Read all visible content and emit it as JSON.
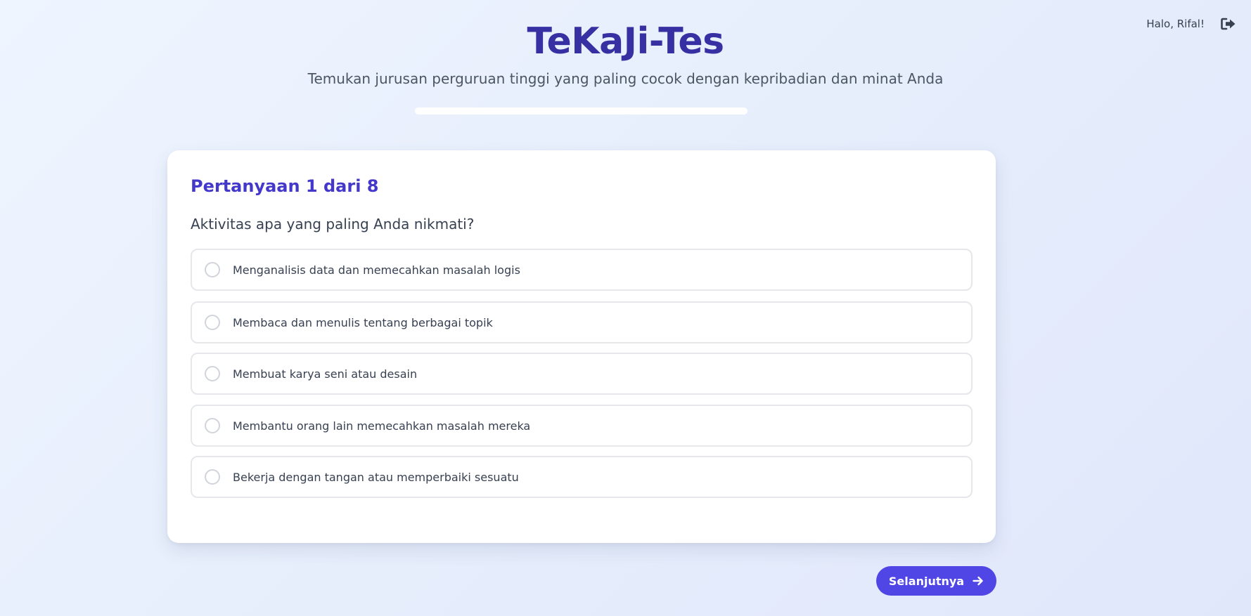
{
  "user": {
    "greeting": "Halo, Rifal!",
    "logout_icon": "sign-out-icon"
  },
  "header": {
    "title": "TeKaJi-Tes",
    "subtitle": "Temukan jurusan perguruan tinggi yang paling cocok dengan kepribadian dan minat Anda"
  },
  "progress": {
    "current": 0,
    "total": 8,
    "fill_fraction": 0
  },
  "question": {
    "counter": "Pertanyaan 1 dari 8",
    "text": "Aktivitas apa yang paling Anda nikmati?",
    "options": [
      {
        "label": "Menganalisis data dan memecahkan masalah logis",
        "selected": false
      },
      {
        "label": "Membaca dan menulis tentang berbagai topik",
        "selected": false
      },
      {
        "label": "Membuat karya seni atau desain",
        "selected": false
      },
      {
        "label": "Membantu orang lain memecahkan masalah mereka",
        "selected": false
      },
      {
        "label": "Bekerja dengan tangan atau memperbaiki sesuatu",
        "selected": false
      }
    ]
  },
  "navigation": {
    "next_label": "Selanjutnya",
    "next_icon": "arrow-right-icon"
  },
  "colors": {
    "title": "#3730a3",
    "accent": "#4f46e5",
    "question_counter": "#4338ca",
    "option_border": "#e5e7eb"
  }
}
